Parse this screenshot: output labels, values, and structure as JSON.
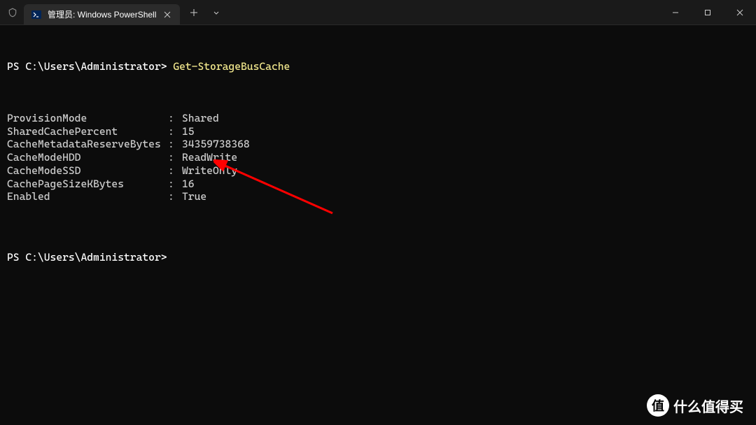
{
  "tab": {
    "title": "管理员: Windows PowerShell"
  },
  "prompt1": {
    "path": "PS C:\\Users\\Administrator> ",
    "command": "Get-StorageBusCache"
  },
  "output": [
    {
      "key": "ProvisionMode",
      "value": "Shared"
    },
    {
      "key": "SharedCachePercent",
      "value": "15"
    },
    {
      "key": "CacheMetadataReserveBytes",
      "value": "34359738368"
    },
    {
      "key": "CacheModeHDD",
      "value": "ReadWrite"
    },
    {
      "key": "CacheModeSSD",
      "value": "WriteOnly"
    },
    {
      "key": "CachePageSizeKBytes",
      "value": "16"
    },
    {
      "key": "Enabled",
      "value": "True"
    }
  ],
  "prompt2": {
    "path": "PS C:\\Users\\Administrator>"
  },
  "watermark": {
    "badge": "值",
    "text": "什么值得买"
  }
}
